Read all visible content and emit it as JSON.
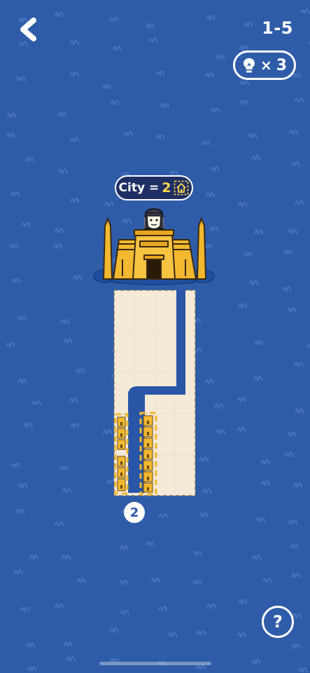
{
  "header": {
    "back_icon": "chevron-left-icon",
    "level": "1-5",
    "hints": {
      "icon": "lightbulb-icon",
      "times": "×",
      "count": "3"
    }
  },
  "goal": {
    "label": "City =",
    "value": "2",
    "icon": "house-target-icon"
  },
  "board": {
    "river_count": "2"
  },
  "footer": {
    "help_label": "?"
  },
  "colors": {
    "background": "#2f5ca8",
    "river": "#2a56a8",
    "sand": "#f4ead7",
    "city": "#f2b830",
    "pill_bg": "#1e2f63"
  }
}
